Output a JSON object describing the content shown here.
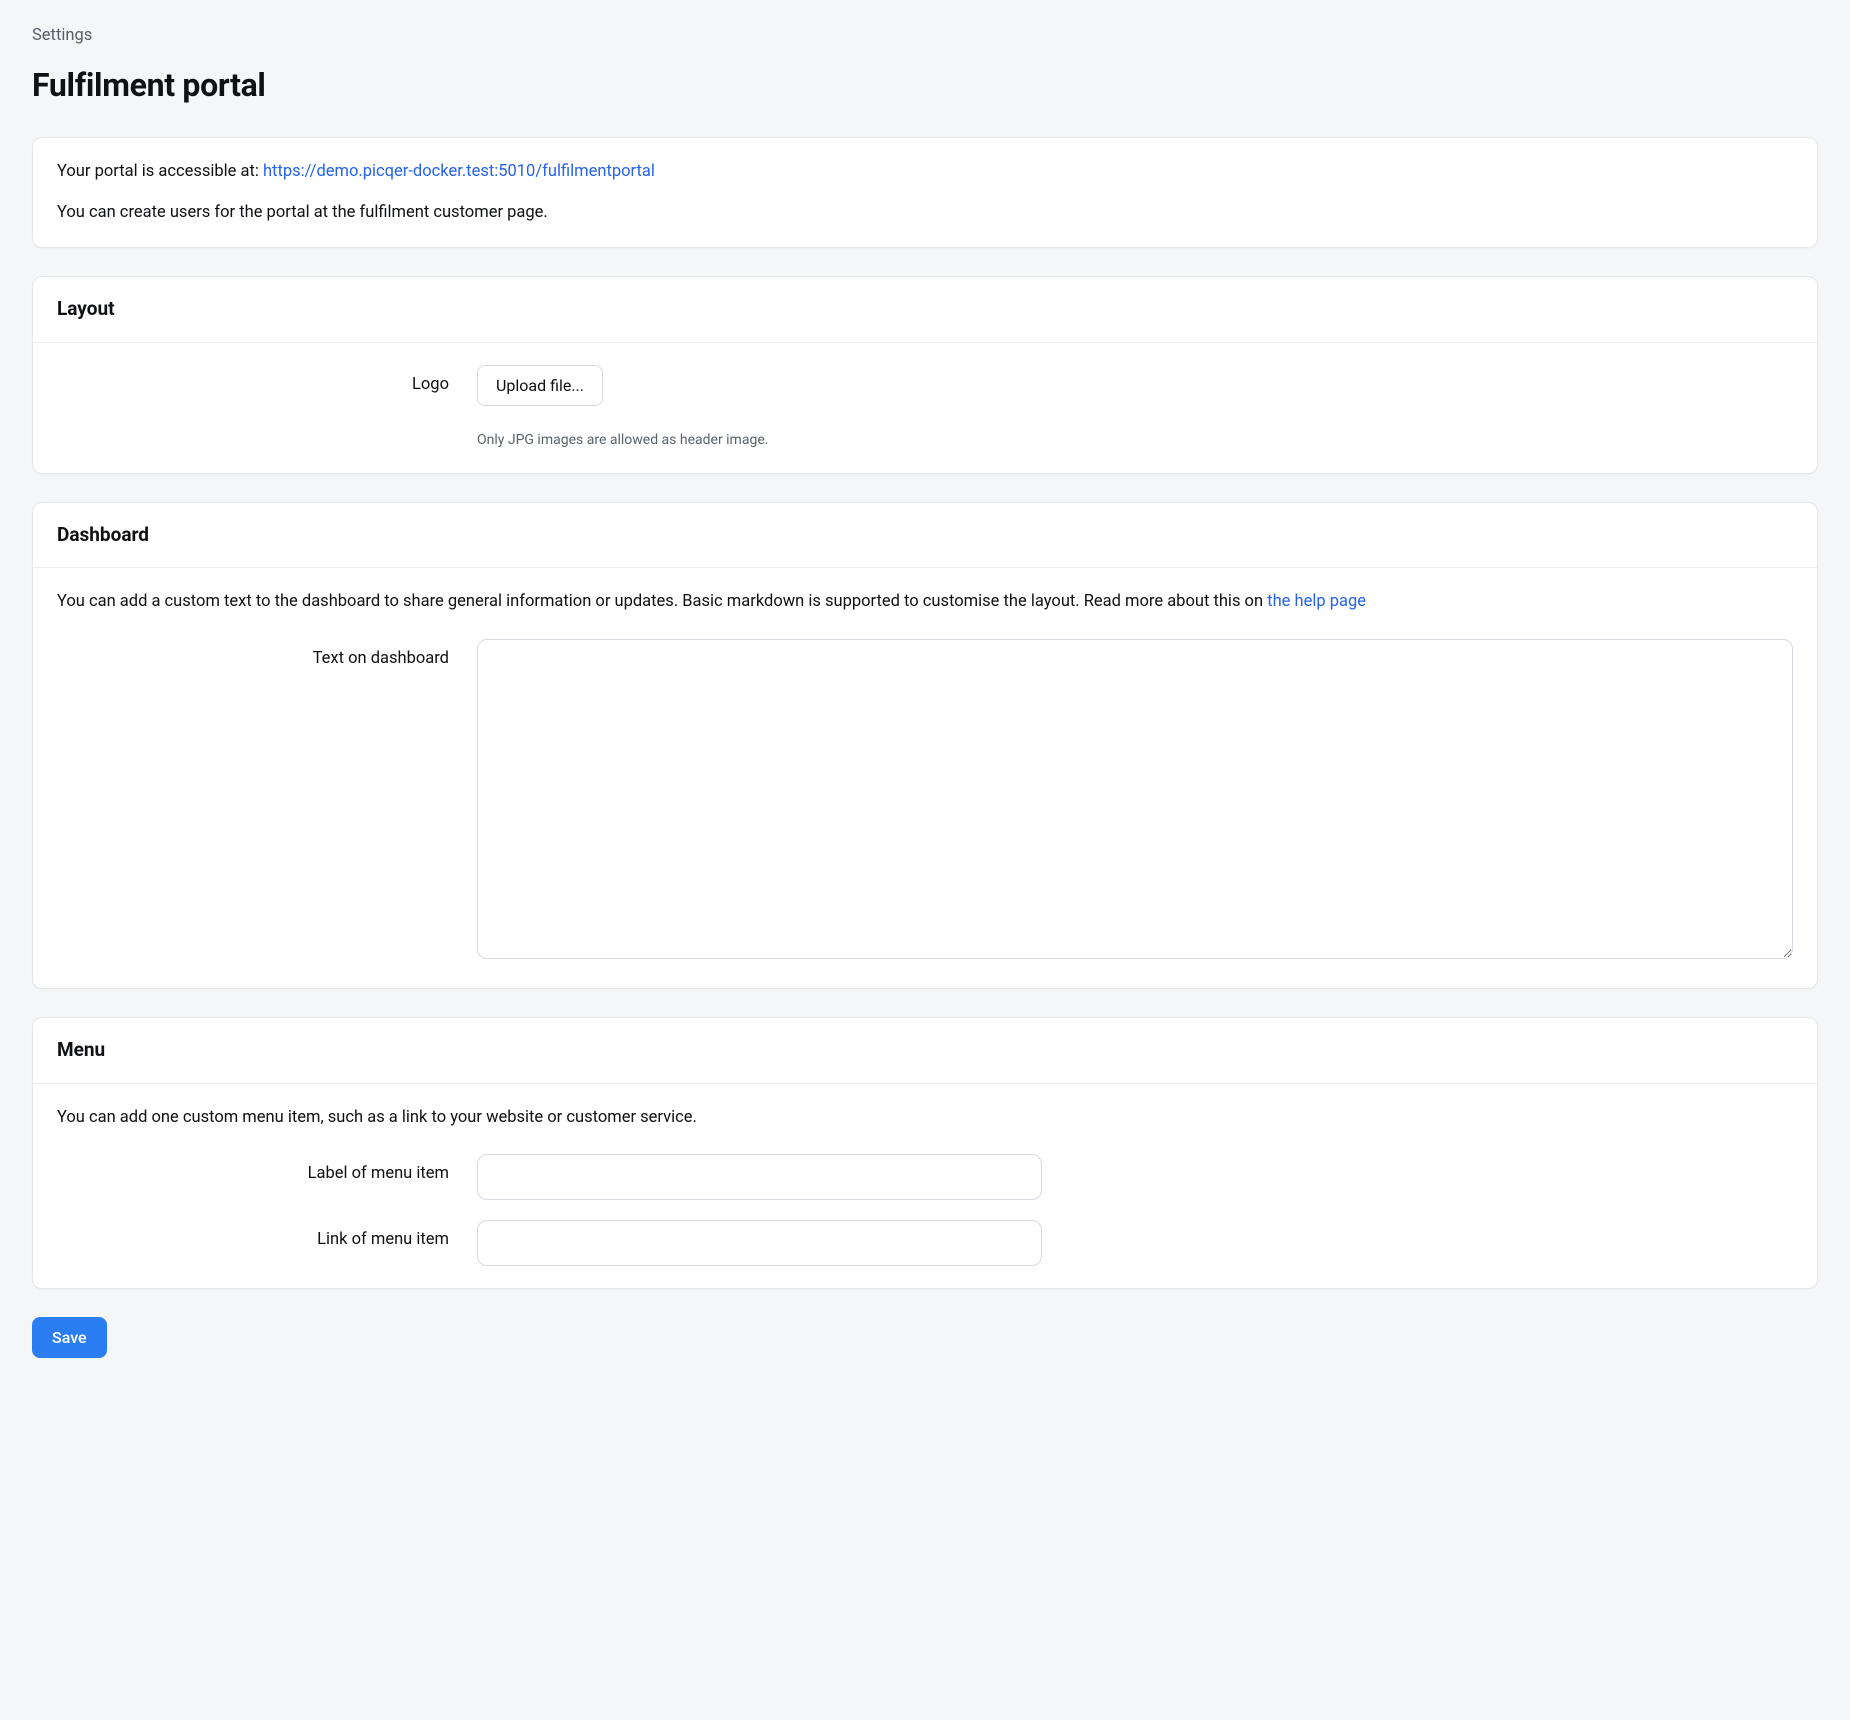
{
  "breadcrumb": {
    "label": "Settings"
  },
  "page": {
    "title": "Fulfilment portal"
  },
  "intro": {
    "accessible_prefix": "Your portal is accessible at: ",
    "url": "https://demo.picqer-docker.test:5010/fulfilmentportal",
    "users_text": "You can create users for the portal at the fulfilment customer page."
  },
  "layout": {
    "heading": "Layout",
    "logo_label": "Logo",
    "upload_label": "Upload file...",
    "helper": "Only JPG images are allowed as header image."
  },
  "dashboard": {
    "heading": "Dashboard",
    "intro_prefix": "You can add a custom text to the dashboard to share general information or updates. Basic markdown is supported to customise the layout. Read more about this on ",
    "help_link_label": "the help page",
    "text_label": "Text on dashboard",
    "text_value": ""
  },
  "menu": {
    "heading": "Menu",
    "intro": "You can add one custom menu item, such as a link to your website or customer service.",
    "label_field_label": "Label of menu item",
    "label_field_value": "",
    "link_field_label": "Link of menu item",
    "link_field_value": ""
  },
  "actions": {
    "save_label": "Save"
  }
}
